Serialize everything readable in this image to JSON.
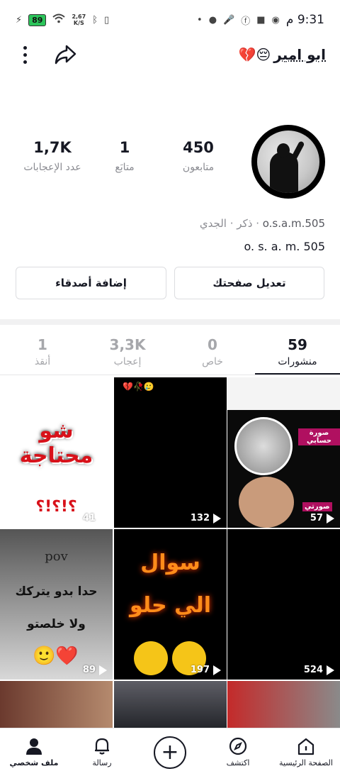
{
  "status": {
    "battery": "89",
    "speed_value": "2,67",
    "speed_unit": "K/S",
    "time": "9:31",
    "ampm": "م"
  },
  "profile": {
    "username": "ابو امير",
    "username_emoji": "😔💔",
    "handle": "o.s.a.m.505",
    "gender": "ذكر",
    "zodiac": "الجدي",
    "separator": "·",
    "display_name": "o. s. a. m. 505"
  },
  "stats": {
    "followers": {
      "value": "450",
      "label": "متابعون"
    },
    "following": {
      "value": "1",
      "label": "متابَع"
    },
    "likes": {
      "value": "1,7K",
      "label": "عدد الإعجابات"
    }
  },
  "buttons": {
    "edit_profile": "تعديل صفحتك",
    "add_friends": "إضافة أصدقاء"
  },
  "tabs": [
    {
      "count": "59",
      "label": "منشورات"
    },
    {
      "count": "0",
      "label": "خاص"
    },
    {
      "count": "3,3K",
      "label": "إعجاب"
    },
    {
      "count": "1",
      "label": "أنقذ"
    }
  ],
  "videos": [
    {
      "views": "41",
      "overlay": "شو محتاجة",
      "overlay2": "؟!؟!؟"
    },
    {
      "views": "132",
      "overlay": "🥲🥀💔"
    },
    {
      "views": "57",
      "overlay": "صورة حسابي",
      "overlay2": "صورتي"
    },
    {
      "views": "89",
      "overlay": "pov",
      "overlay2": "حدا بدو يتركك",
      "overlay3": "ولا خلصتو"
    },
    {
      "views": "197",
      "overlay": "سوال",
      "overlay2": "الي حلو"
    },
    {
      "views": "524"
    }
  ],
  "nav": {
    "home": "الصفحة الرئيسية",
    "discover": "اكتشف",
    "inbox": "رسالة",
    "profile": "ملف شخصي"
  },
  "colors": {
    "text": "#161823",
    "muted": "#8a8b91",
    "battery": "#2bc45a"
  }
}
